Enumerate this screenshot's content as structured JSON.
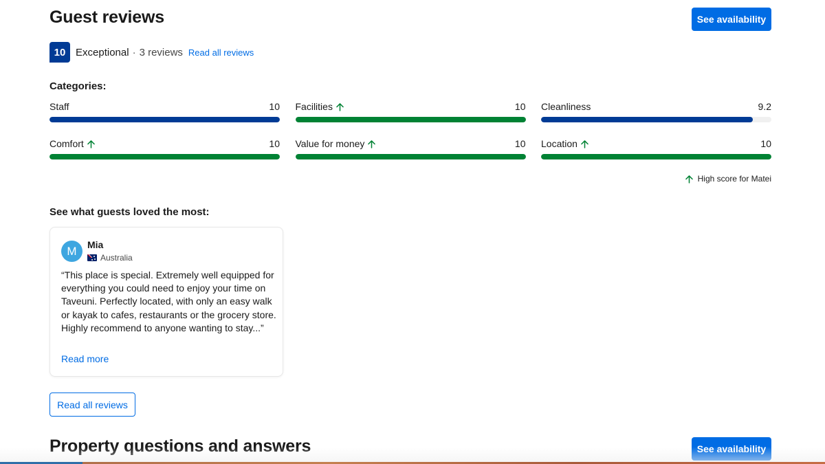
{
  "header": {
    "title": "Guest reviews",
    "cta_label": "See availability"
  },
  "summary": {
    "score": "10",
    "rating_word": "Exceptional",
    "separator": "·",
    "review_count": "3 reviews",
    "read_all_link": "Read all reviews"
  },
  "categories": {
    "title": "Categories:",
    "items": [
      {
        "label": "Staff",
        "score": "10",
        "value": 10,
        "high_score": false,
        "color": "#003b95"
      },
      {
        "label": "Facilities",
        "score": "10",
        "value": 10,
        "high_score": true,
        "color": "#008234"
      },
      {
        "label": "Cleanliness",
        "score": "9.2",
        "value": 9.2,
        "high_score": false,
        "color": "#003b95"
      },
      {
        "label": "Comfort",
        "score": "10",
        "value": 10,
        "high_score": true,
        "color": "#008234"
      },
      {
        "label": "Value for money",
        "score": "10",
        "value": 10,
        "high_score": true,
        "color": "#008234"
      },
      {
        "label": "Location",
        "score": "10",
        "value": 10,
        "high_score": true,
        "color": "#008234"
      }
    ],
    "max_value": 10,
    "high_score_note": "High score for Matei"
  },
  "loved": {
    "title": "See what guests loved the most:",
    "review": {
      "avatar_initial": "M",
      "name": "Mia",
      "country": "Australia",
      "flag_icon": "australia-flag-icon",
      "text": "“This place is special. Extremely well equipped for everything you could need to enjoy your time on Taveuni. Perfectly located, with only an easy walk or kayak to cafes, restaurants or the grocery store. Highly recommend to anyone wanting to stay...”",
      "read_more": "Read more"
    },
    "read_all_button": "Read all reviews"
  },
  "qa": {
    "title": "Property questions and answers",
    "cta_label": "See availability"
  },
  "colors": {
    "primary": "#006ce4",
    "badge": "#003b95",
    "green": "#008234"
  }
}
